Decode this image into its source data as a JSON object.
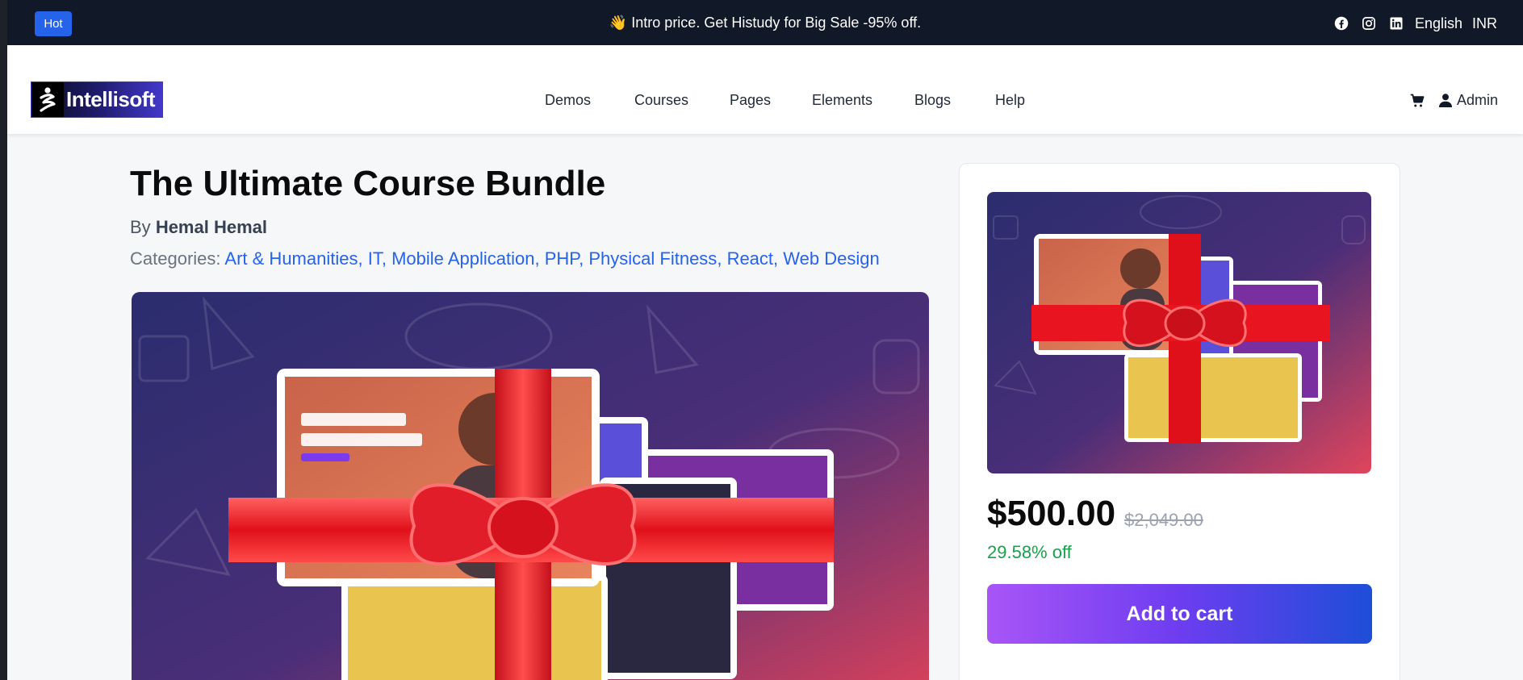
{
  "topbar": {
    "badge": "Hot",
    "announcement": "👋 Intro price. Get Histudy for Big Sale -95% off.",
    "language": "English",
    "currency": "INR",
    "social_icons": [
      "facebook-icon",
      "instagram-icon",
      "linkedin-icon"
    ]
  },
  "header": {
    "logo_text": "Intellisoft",
    "nav": [
      "Demos",
      "Courses",
      "Pages",
      "Elements",
      "Blogs",
      "Help"
    ],
    "user_label": "Admin"
  },
  "course": {
    "title": "The Ultimate Course Bundle",
    "by_prefix": "By",
    "author": "Hemal Hemal",
    "categories_label": "Categories:",
    "categories": [
      "Art & Humanities",
      "IT",
      "Mobile Application",
      "PHP",
      "Physical Fitness",
      "React",
      "Web Design"
    ]
  },
  "sidebar": {
    "price": "$500.00",
    "original_price": "$2,049.00",
    "discount": "29.58% off",
    "add_to_cart": "Add to cart"
  },
  "colors": {
    "topbar_bg": "#111827",
    "accent": "#2563eb",
    "discount": "#16a34a",
    "button_gradient": [
      "#a855f7",
      "#1d4ed8"
    ]
  }
}
